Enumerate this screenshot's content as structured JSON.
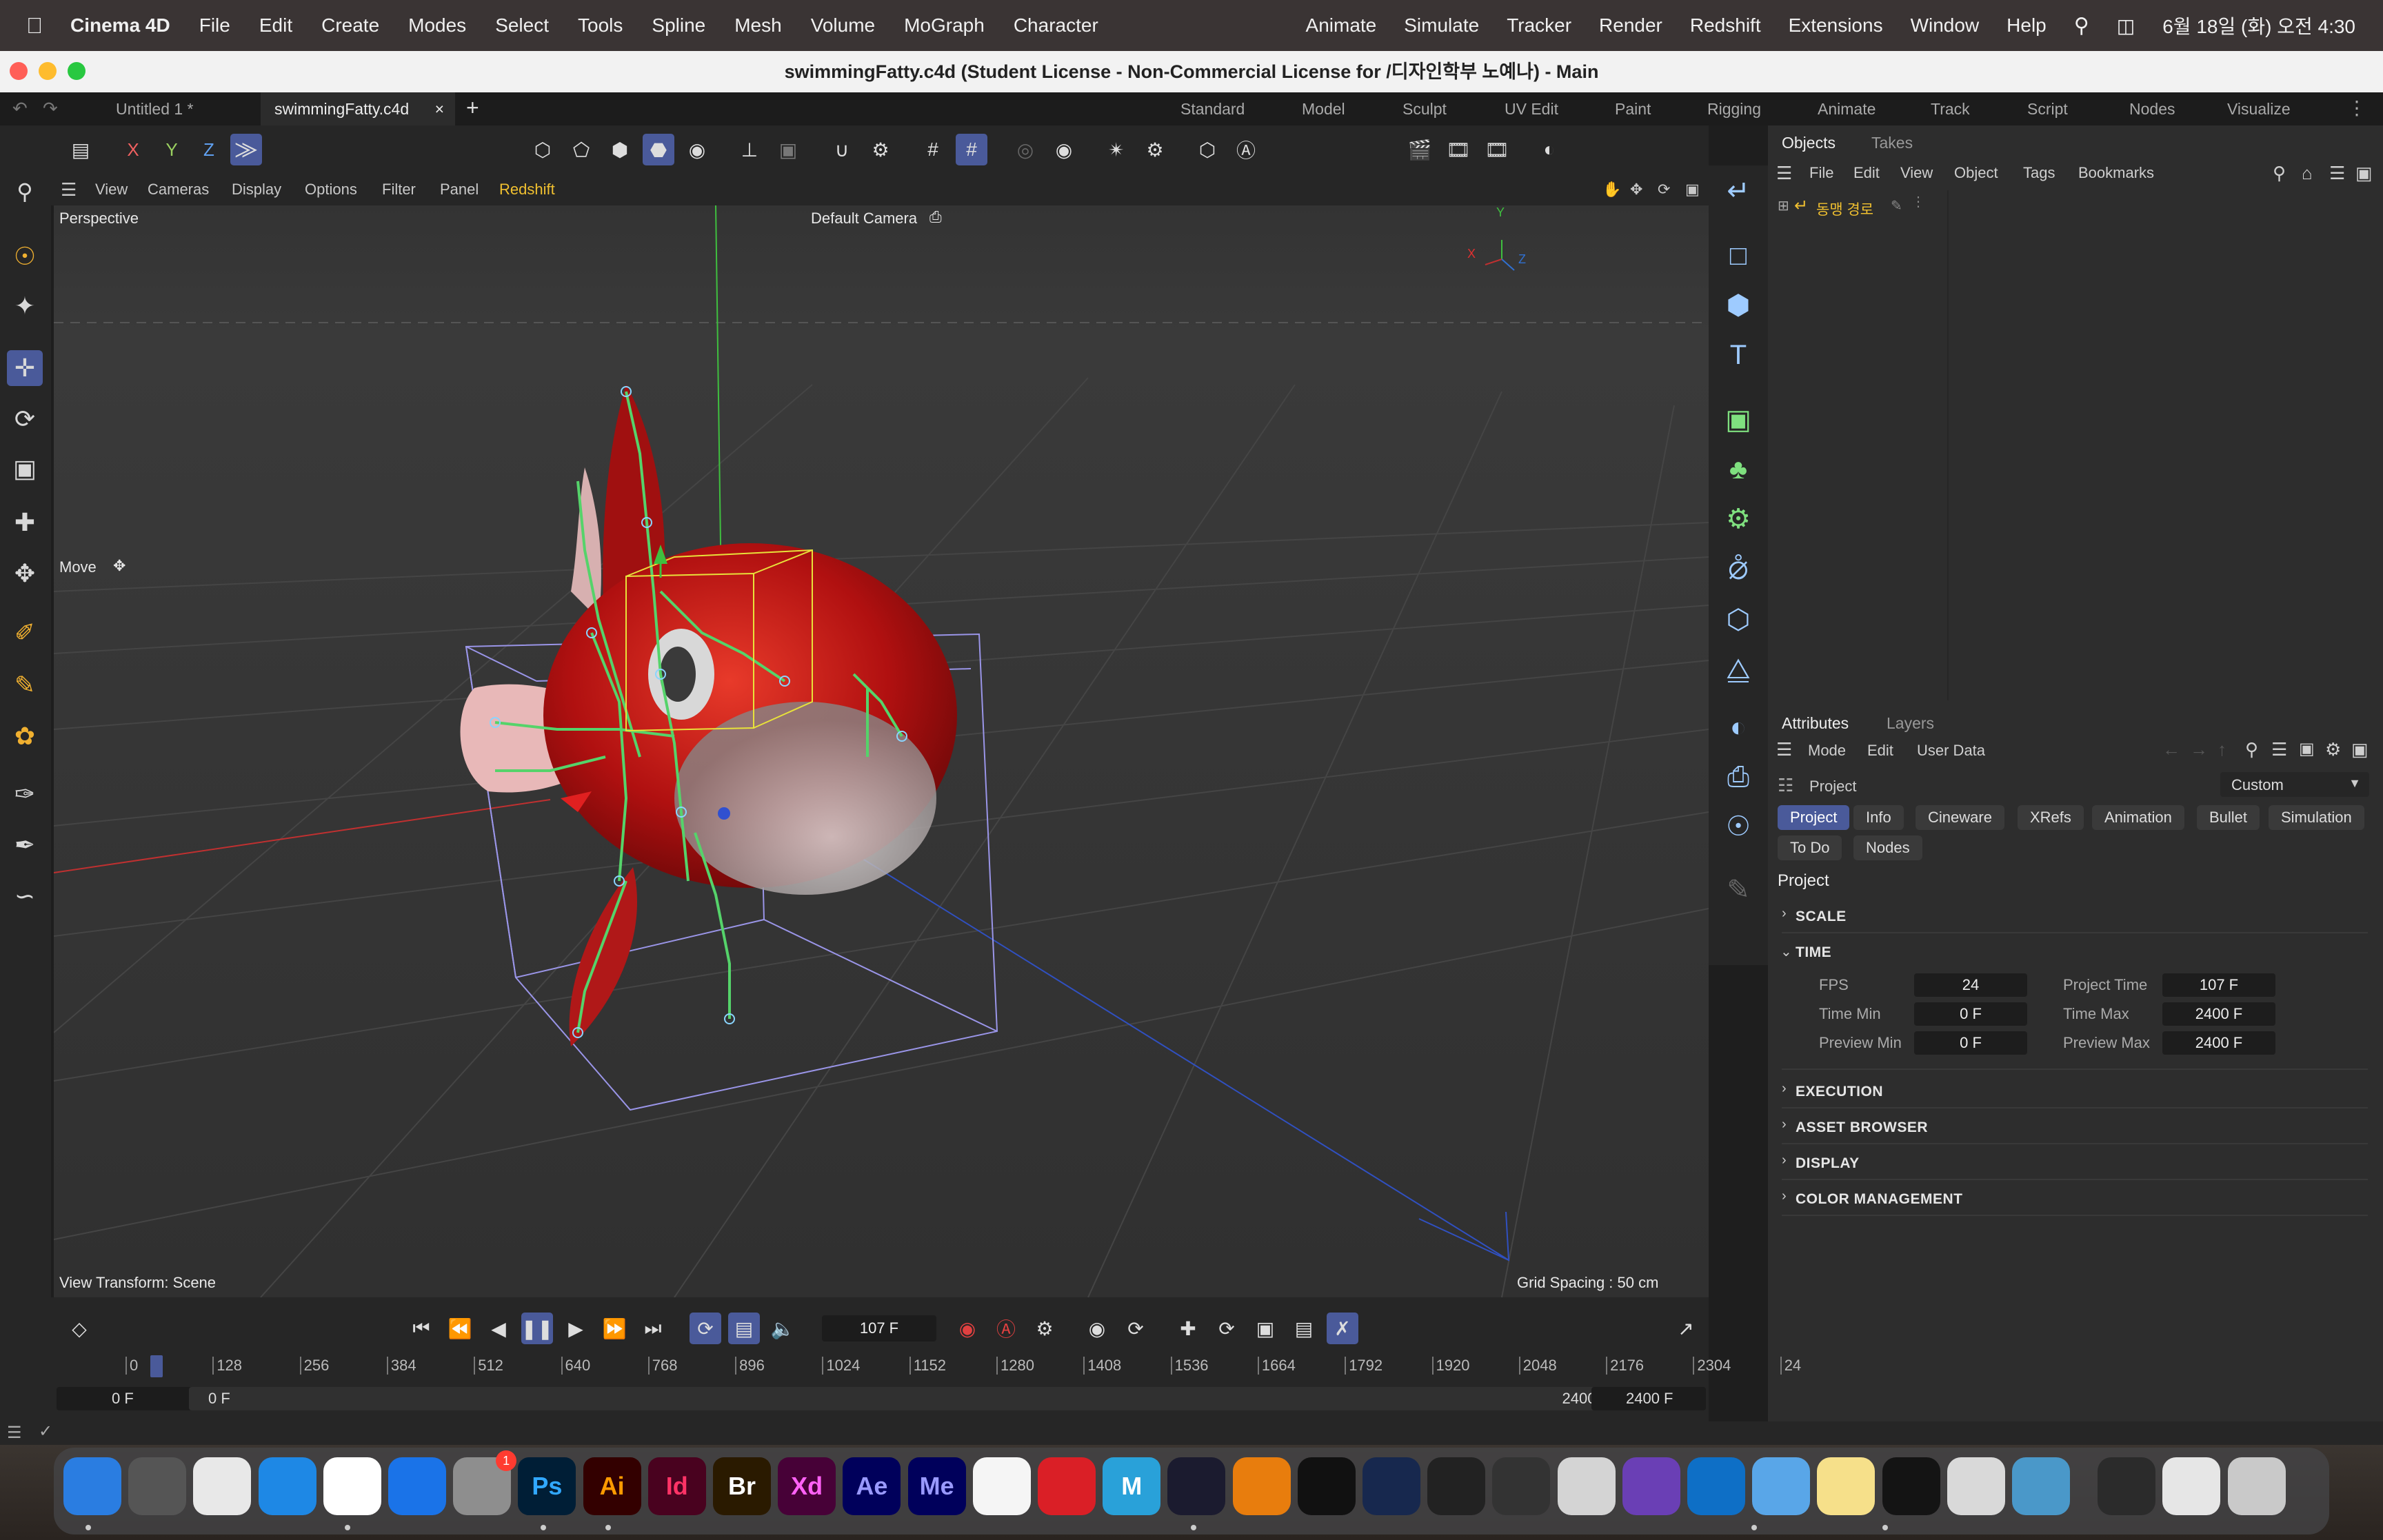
{
  "mac_menubar": {
    "app_name": "Cinema 4D",
    "left_items": [
      "File",
      "Edit",
      "Create",
      "Modes",
      "Select",
      "Tools",
      "Spline",
      "Mesh",
      "Volume",
      "MoGraph",
      "Character"
    ],
    "right_items": [
      "Animate",
      "Simulate",
      "Tracker",
      "Render",
      "Redshift",
      "Extensions",
      "Window",
      "Help"
    ],
    "clock": "6월 18일 (화) 오전 4:30"
  },
  "window": {
    "title": "swimmingFatty.c4d (Student License - Non-Commercial License for /디자인학부 노예나) - Main"
  },
  "doc_tabs": {
    "tab1": "Untitled 1 *",
    "tab2": "swimmingFatty.c4d",
    "close": "×",
    "add": "+"
  },
  "layouts": [
    "Standard",
    "Model",
    "Sculpt",
    "UV Edit",
    "Paint",
    "Rigging",
    "Animate",
    "Track",
    "Script",
    "Nodes",
    "Visualize"
  ],
  "axis_buttons": [
    "X",
    "Y",
    "Z"
  ],
  "viewport_menu": [
    "View",
    "Cameras",
    "Display",
    "Options",
    "Filter",
    "Panel",
    "Redshift"
  ],
  "viewport": {
    "projection": "Perspective",
    "camera": "Default Camera",
    "tool_label": "Move",
    "view_transform": "View Transform: Scene",
    "grid_spacing": "Grid Spacing : 50 cm",
    "axis_labels": {
      "x": "X",
      "y": "Y",
      "z": "Z"
    }
  },
  "objects_panel": {
    "tabs": [
      "Objects",
      "Takes"
    ],
    "menu": [
      "File",
      "Edit",
      "View",
      "Object",
      "Tags",
      "Bookmarks"
    ],
    "object_name": "동맹 경로"
  },
  "attributes_panel": {
    "tabs": [
      "Attributes",
      "Layers"
    ],
    "menu": [
      "Mode",
      "Edit",
      "User Data"
    ],
    "context_label": "Project",
    "preset": "Custom",
    "pills_row1": [
      "Project",
      "Info",
      "Cineware",
      "XRefs",
      "Animation",
      "Bullet",
      "Simulation"
    ],
    "pills_row2": [
      "To Do",
      "Nodes"
    ],
    "heading": "Project",
    "sections": {
      "scale": "SCALE",
      "time": "TIME",
      "execution": "EXECUTION",
      "asset_browser": "ASSET BROWSER",
      "display": "DISPLAY",
      "color_management": "COLOR MANAGEMENT"
    },
    "time_fields": {
      "fps_label": "FPS",
      "fps": "24",
      "project_time_label": "Project Time",
      "project_time": "107 F",
      "time_min_label": "Time Min",
      "time_min": "0 F",
      "time_max_label": "Time Max",
      "time_max": "2400 F",
      "preview_min_label": "Preview Min",
      "preview_min": "0 F",
      "preview_max_label": "Preview Max",
      "preview_max": "2400 F"
    }
  },
  "timeline": {
    "current_frame": "107 F",
    "ticks": [
      "0",
      "128",
      "256",
      "384",
      "512",
      "640",
      "768",
      "896",
      "1024",
      "1152",
      "1280",
      "1408",
      "1536",
      "1664",
      "1792",
      "1920",
      "2048",
      "2176",
      "2304",
      "24"
    ],
    "start_a": "0 F",
    "start_b": "0 F",
    "end_a": "2400 F",
    "end_b": "2400 F",
    "playhead_fraction": 0.0446
  },
  "dock": {
    "badge": "1",
    "apps": [
      "finder-icon",
      "screenshot-icon",
      "launchpad-icon",
      "safari-icon",
      "chrome-icon",
      "app-store-icon",
      "system-settings-icon",
      "photoshop-icon",
      "illustrator-icon",
      "indesign-icon",
      "bridge-icon",
      "xd-icon",
      "after-effects-icon",
      "media-encoder-icon",
      "notes-app-icon",
      "creative-cloud-icon",
      "maya-icon",
      "cinema4d-icon",
      "blender-icon",
      "zbrush-icon",
      "steam-icon",
      "unity-icon",
      "unity-hub-icon",
      "preview-icon",
      "visual-studio-icon",
      "vscode-icon",
      "cloud-app-icon",
      "notes-icon",
      "maxon-icon",
      "boot-camp-icon",
      "qt-icon",
      "folder-icon",
      "downloads-icon",
      "trash-icon"
    ],
    "labels": {
      "ps": "Ps",
      "ai": "Ai",
      "id": "Id",
      "br": "Br",
      "xd": "Xd",
      "ae": "Ae",
      "me": "Me",
      "maya": "M"
    }
  },
  "colors": {
    "accent": "#4a5a9a",
    "fish_body": "#b01010",
    "rig_green": "#55d36a",
    "bbox_yellow": "#e8e23a",
    "bbox_purple": "#9a95e8"
  }
}
